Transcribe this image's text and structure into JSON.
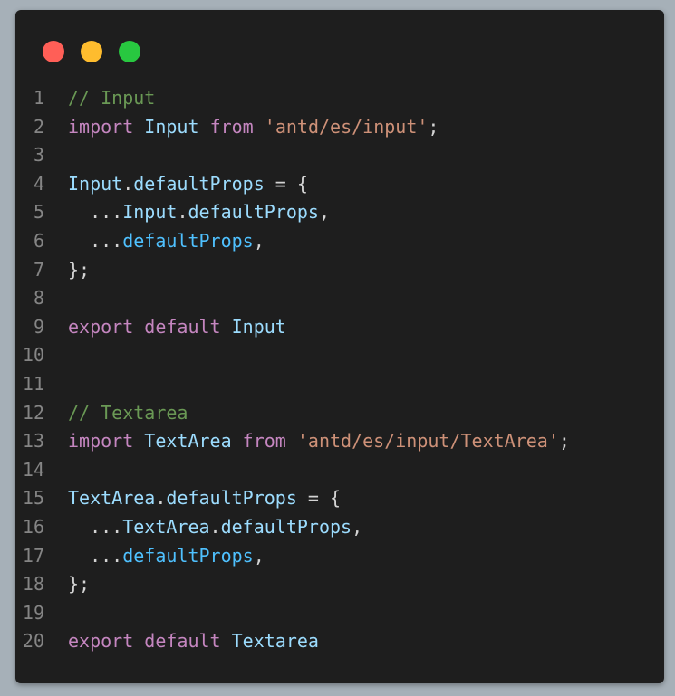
{
  "window": {
    "traffic_lights": [
      {
        "name": "close",
        "color": "#ff5f57"
      },
      {
        "name": "minimize",
        "color": "#febc2e"
      },
      {
        "name": "zoom",
        "color": "#28c840"
      }
    ],
    "background": "#1e1e1e"
  },
  "colors": {
    "comment": "#6a9955",
    "keyword": "#c586c0",
    "string": "#ce9178",
    "identifier": "#9cdcfe",
    "punctuation": "#d4d4d4",
    "variable": "#4fc1ff",
    "line_number": "#858585"
  },
  "code": {
    "lines": [
      {
        "n": "1",
        "tokens": [
          {
            "t": "// Input",
            "c": "comment"
          }
        ]
      },
      {
        "n": "2",
        "tokens": [
          {
            "t": "import",
            "c": "keyword"
          },
          {
            "t": " ",
            "c": "punc"
          },
          {
            "t": "Input",
            "c": "ident"
          },
          {
            "t": " ",
            "c": "punc"
          },
          {
            "t": "from",
            "c": "keyword"
          },
          {
            "t": " ",
            "c": "punc"
          },
          {
            "t": "'antd/es/input'",
            "c": "string"
          },
          {
            "t": ";",
            "c": "punc"
          }
        ]
      },
      {
        "n": "3",
        "tokens": []
      },
      {
        "n": "4",
        "tokens": [
          {
            "t": "Input",
            "c": "ident"
          },
          {
            "t": ".",
            "c": "punc"
          },
          {
            "t": "defaultProps",
            "c": "ident"
          },
          {
            "t": " = {",
            "c": "punc"
          }
        ]
      },
      {
        "n": "5",
        "tokens": [
          {
            "t": "  ...",
            "c": "punc"
          },
          {
            "t": "Input",
            "c": "ident"
          },
          {
            "t": ".",
            "c": "punc"
          },
          {
            "t": "defaultProps",
            "c": "ident"
          },
          {
            "t": ",",
            "c": "punc"
          }
        ]
      },
      {
        "n": "6",
        "tokens": [
          {
            "t": "  ...",
            "c": "punc"
          },
          {
            "t": "defaultProps",
            "c": "variable"
          },
          {
            "t": ",",
            "c": "punc"
          }
        ]
      },
      {
        "n": "7",
        "tokens": [
          {
            "t": "};",
            "c": "punc"
          }
        ]
      },
      {
        "n": "8",
        "tokens": []
      },
      {
        "n": "9",
        "tokens": [
          {
            "t": "export",
            "c": "keyword"
          },
          {
            "t": " ",
            "c": "punc"
          },
          {
            "t": "default",
            "c": "keyword"
          },
          {
            "t": " ",
            "c": "punc"
          },
          {
            "t": "Input",
            "c": "ident"
          }
        ]
      },
      {
        "n": "10",
        "tokens": []
      },
      {
        "n": "11",
        "tokens": []
      },
      {
        "n": "12",
        "tokens": [
          {
            "t": "// Textarea",
            "c": "comment"
          }
        ]
      },
      {
        "n": "13",
        "tokens": [
          {
            "t": "import",
            "c": "keyword"
          },
          {
            "t": " ",
            "c": "punc"
          },
          {
            "t": "TextArea",
            "c": "ident"
          },
          {
            "t": " ",
            "c": "punc"
          },
          {
            "t": "from",
            "c": "keyword"
          },
          {
            "t": " ",
            "c": "punc"
          },
          {
            "t": "'antd/es/input/TextArea'",
            "c": "string"
          },
          {
            "t": ";",
            "c": "punc"
          }
        ]
      },
      {
        "n": "14",
        "tokens": []
      },
      {
        "n": "15",
        "tokens": [
          {
            "t": "TextArea",
            "c": "ident"
          },
          {
            "t": ".",
            "c": "punc"
          },
          {
            "t": "defaultProps",
            "c": "ident"
          },
          {
            "t": " = {",
            "c": "punc"
          }
        ]
      },
      {
        "n": "16",
        "tokens": [
          {
            "t": "  ...",
            "c": "punc"
          },
          {
            "t": "TextArea",
            "c": "ident"
          },
          {
            "t": ".",
            "c": "punc"
          },
          {
            "t": "defaultProps",
            "c": "ident"
          },
          {
            "t": ",",
            "c": "punc"
          }
        ]
      },
      {
        "n": "17",
        "tokens": [
          {
            "t": "  ...",
            "c": "punc"
          },
          {
            "t": "defaultProps",
            "c": "variable"
          },
          {
            "t": ",",
            "c": "punc"
          }
        ]
      },
      {
        "n": "18",
        "tokens": [
          {
            "t": "};",
            "c": "punc"
          }
        ]
      },
      {
        "n": "19",
        "tokens": []
      },
      {
        "n": "20",
        "tokens": [
          {
            "t": "export",
            "c": "keyword"
          },
          {
            "t": " ",
            "c": "punc"
          },
          {
            "t": "default",
            "c": "keyword"
          },
          {
            "t": " ",
            "c": "punc"
          },
          {
            "t": "Textarea",
            "c": "ident"
          }
        ]
      }
    ]
  }
}
